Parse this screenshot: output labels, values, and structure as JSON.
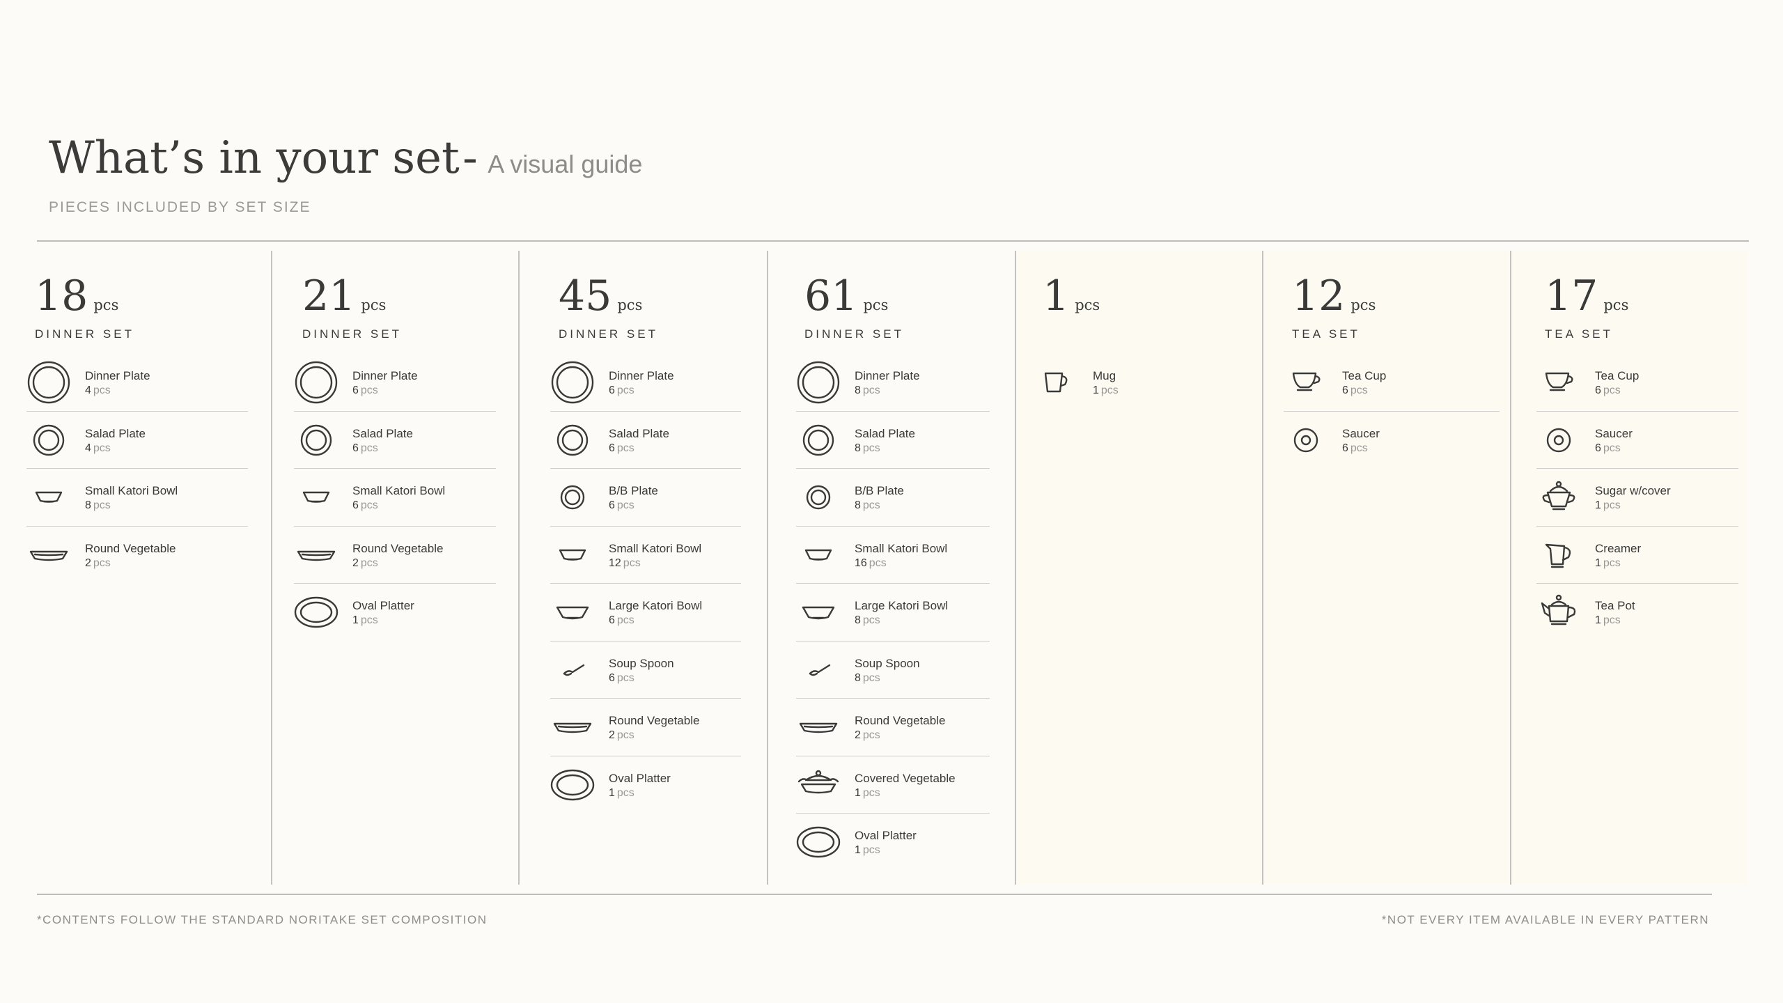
{
  "header": {
    "title": "What’s in your set",
    "dash": "-",
    "subtitle": "A visual guide",
    "kicker": "PIECES INCLUDED BY SET SIZE"
  },
  "footer": {
    "left": "*CONTENTS FOLLOW THE STANDARD NORITAKE SET COMPOSITION",
    "right": "*NOT EVERY ITEM AVAILABLE IN EVERY PATTERN"
  },
  "unit": "pcs",
  "colors": {
    "background": "#fcfbf8",
    "tea_background": "#fdfaf2",
    "text": "#3a3a38",
    "muted": "#9a9995",
    "rule": "#bdbcb8"
  },
  "sets": [
    {
      "count": "18",
      "type": "DINNER SET",
      "tea": false,
      "items": [
        {
          "name": "Dinner Plate",
          "qty": "4",
          "icon": "dinner-plate-icon"
        },
        {
          "name": "Salad Plate",
          "qty": "4",
          "icon": "salad-plate-icon"
        },
        {
          "name": "Small Katori Bowl",
          "qty": "8",
          "icon": "small-bowl-icon"
        },
        {
          "name": "Round Vegetable",
          "qty": "2",
          "icon": "round-vegetable-icon"
        }
      ]
    },
    {
      "count": "21",
      "type": "DINNER SET",
      "tea": false,
      "items": [
        {
          "name": "Dinner Plate",
          "qty": "6",
          "icon": "dinner-plate-icon"
        },
        {
          "name": "Salad Plate",
          "qty": "6",
          "icon": "salad-plate-icon"
        },
        {
          "name": "Small Katori Bowl",
          "qty": "6",
          "icon": "small-bowl-icon"
        },
        {
          "name": "Round Vegetable",
          "qty": "2",
          "icon": "round-vegetable-icon"
        },
        {
          "name": "Oval Platter",
          "qty": "1",
          "icon": "oval-platter-icon"
        }
      ]
    },
    {
      "count": "45",
      "type": "DINNER SET",
      "tea": false,
      "items": [
        {
          "name": "Dinner Plate",
          "qty": "6",
          "icon": "dinner-plate-icon"
        },
        {
          "name": "Salad Plate",
          "qty": "6",
          "icon": "salad-plate-icon"
        },
        {
          "name": "B/B Plate",
          "qty": "6",
          "icon": "bb-plate-icon"
        },
        {
          "name": "Small Katori Bowl",
          "qty": "12",
          "icon": "small-bowl-icon"
        },
        {
          "name": "Large Katori Bowl",
          "qty": "6",
          "icon": "large-bowl-icon"
        },
        {
          "name": "Soup Spoon",
          "qty": "6",
          "icon": "soup-spoon-icon"
        },
        {
          "name": "Round Vegetable",
          "qty": "2",
          "icon": "round-vegetable-icon"
        },
        {
          "name": "Oval Platter",
          "qty": "1",
          "icon": "oval-platter-icon"
        }
      ]
    },
    {
      "count": "61",
      "type": "DINNER SET",
      "tea": false,
      "items": [
        {
          "name": "Dinner Plate",
          "qty": "8",
          "icon": "dinner-plate-icon"
        },
        {
          "name": "Salad Plate",
          "qty": "8",
          "icon": "salad-plate-icon"
        },
        {
          "name": "B/B Plate",
          "qty": "8",
          "icon": "bb-plate-icon"
        },
        {
          "name": "Small Katori Bowl",
          "qty": "16",
          "icon": "small-bowl-icon"
        },
        {
          "name": "Large Katori Bowl",
          "qty": "8",
          "icon": "large-bowl-icon"
        },
        {
          "name": "Soup Spoon",
          "qty": "8",
          "icon": "soup-spoon-icon"
        },
        {
          "name": "Round Vegetable",
          "qty": "2",
          "icon": "round-vegetable-icon"
        },
        {
          "name": "Covered Vegetable",
          "qty": "1",
          "icon": "covered-vegetable-icon"
        },
        {
          "name": "Oval Platter",
          "qty": "1",
          "icon": "oval-platter-icon"
        }
      ]
    },
    {
      "count": "1",
      "type": "",
      "tea": true,
      "items": [
        {
          "name": "Mug",
          "qty": "1",
          "icon": "mug-icon"
        }
      ]
    },
    {
      "count": "12",
      "type": "TEA SET",
      "tea": true,
      "items": [
        {
          "name": "Tea Cup",
          "qty": "6",
          "icon": "tea-cup-icon"
        },
        {
          "name": "Saucer",
          "qty": "6",
          "icon": "saucer-icon"
        }
      ]
    },
    {
      "count": "17",
      "type": "TEA SET",
      "tea": true,
      "items": [
        {
          "name": "Tea Cup",
          "qty": "6",
          "icon": "tea-cup-icon"
        },
        {
          "name": "Saucer",
          "qty": "6",
          "icon": "saucer-icon"
        },
        {
          "name": "Sugar w/cover",
          "qty": "1",
          "icon": "sugar-bowl-icon"
        },
        {
          "name": "Creamer",
          "qty": "1",
          "icon": "creamer-icon"
        },
        {
          "name": "Tea Pot",
          "qty": "1",
          "icon": "tea-pot-icon"
        }
      ]
    }
  ]
}
